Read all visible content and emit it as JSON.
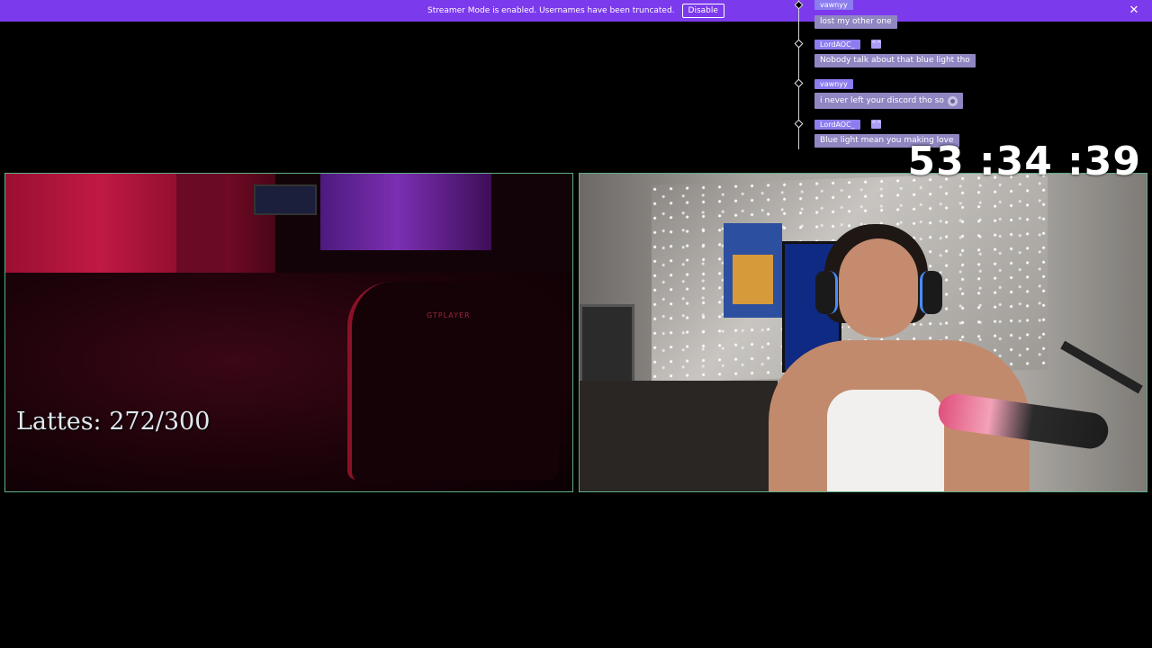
{
  "banner": {
    "text": "Streamer Mode is enabled. Usernames have been truncated.",
    "button_label": "Disable",
    "close_glyph": "✕",
    "color": "#7c3aed"
  },
  "chat": {
    "messages": [
      {
        "user": "vawnyy",
        "text": "lost my other one",
        "badge": false
      },
      {
        "user": "LordAOC_",
        "text": "Nobody talk about that blue light tho",
        "badge": true
      },
      {
        "user": "vawnyy",
        "text": "i never left your discord tho so",
        "badge": false,
        "emote": "sad-emote"
      },
      {
        "user": "LordAOC_",
        "text": "Blue light mean you making love",
        "badge": true
      }
    ],
    "badge_glyph": "^^"
  },
  "timer": "53 :34 :39",
  "left_cam": {
    "counter_text": "Lattes: 272/300",
    "chair_text": "GTPLAYER"
  }
}
